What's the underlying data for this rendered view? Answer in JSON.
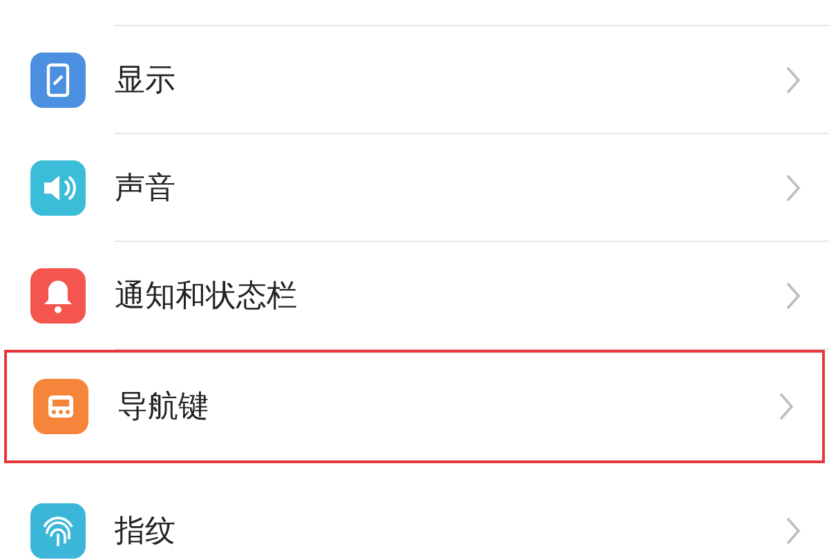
{
  "settings": [
    {
      "label": "显示",
      "kind": "display",
      "color": "#4a8fe0",
      "selected": false
    },
    {
      "label": "声音",
      "kind": "sound",
      "color": "#3bbcd8",
      "selected": false
    },
    {
      "label": "通知和状态栏",
      "kind": "bell",
      "color": "#f4554f",
      "selected": false
    },
    {
      "label": "导航键",
      "kind": "nav",
      "color": "#f5853a",
      "selected": true
    },
    {
      "label": "指纹",
      "kind": "fingerprint",
      "color": "#3bb6d8",
      "selected": false
    }
  ]
}
